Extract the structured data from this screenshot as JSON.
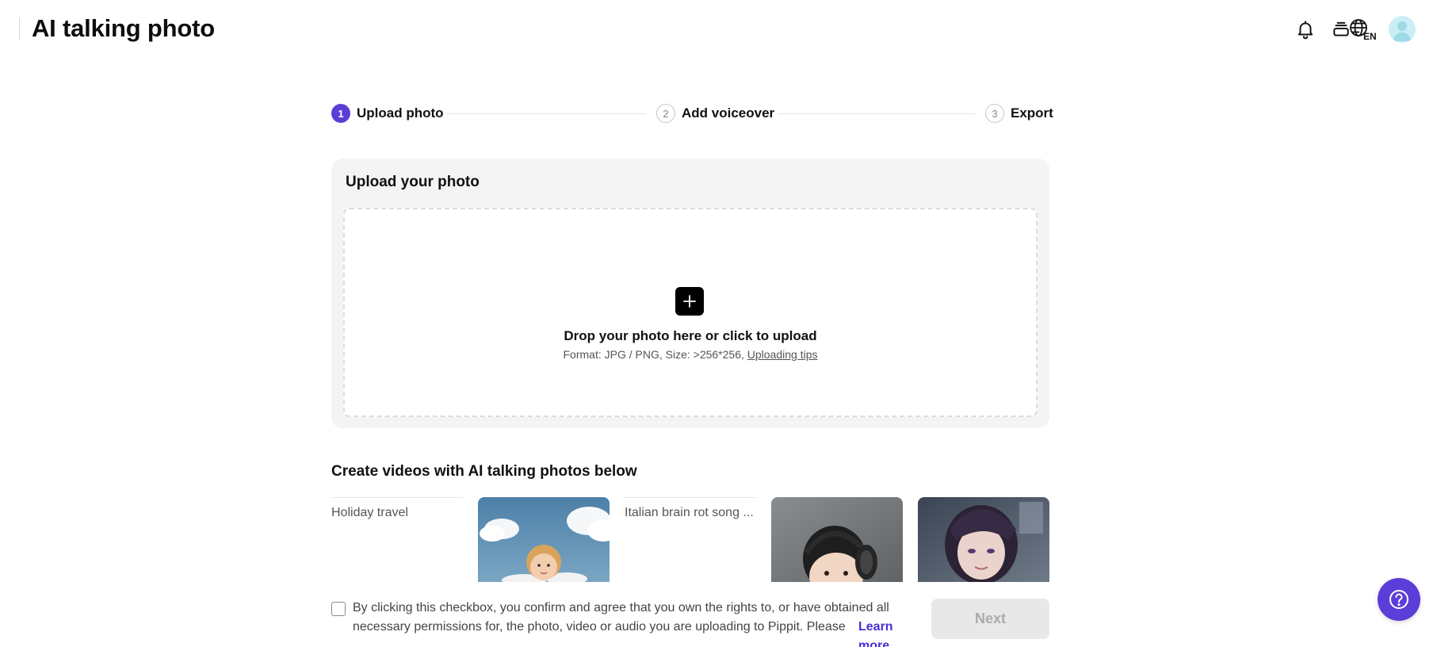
{
  "header": {
    "title": "AI talking photo",
    "icons": [
      "bell-icon",
      "stack-icon",
      "globe-language-icon",
      "avatar"
    ],
    "language_badge": "EN"
  },
  "stepper": {
    "steps": [
      {
        "number": "1",
        "label": "Upload photo",
        "state": "active"
      },
      {
        "number": "2",
        "label": "Add voiceover",
        "state": "inactive"
      },
      {
        "number": "3",
        "label": "Export",
        "state": "inactive"
      }
    ],
    "active_color": "#5b3ed8"
  },
  "upload": {
    "card_title": "Upload your photo",
    "drop_text": "Drop your photo here or click to upload",
    "format_text": "Format: JPG / PNG, Size: >256*256, ",
    "tips_link": "Uploading tips"
  },
  "gallery": {
    "title": "Create videos with AI talking photos below",
    "items": [
      {
        "type": "text",
        "label": "Holiday travel"
      },
      {
        "type": "image",
        "label": "cupid-child-clouds-image"
      },
      {
        "type": "text",
        "label": "Italian brain rot song ..."
      },
      {
        "type": "image",
        "label": "baby-headphones-image"
      },
      {
        "type": "image",
        "label": "anime-character-image"
      }
    ]
  },
  "footer": {
    "consent_text": "By clicking this checkbox, you confirm and agree that you own the rights to, or have obtained all necessary permissions for, the photo, video or audio you are uploading to Pippit. Please",
    "learn_more": "Learn more",
    "next_label": "Next",
    "link_color": "#4b2bd6"
  },
  "help": {
    "icon": "question-icon"
  }
}
